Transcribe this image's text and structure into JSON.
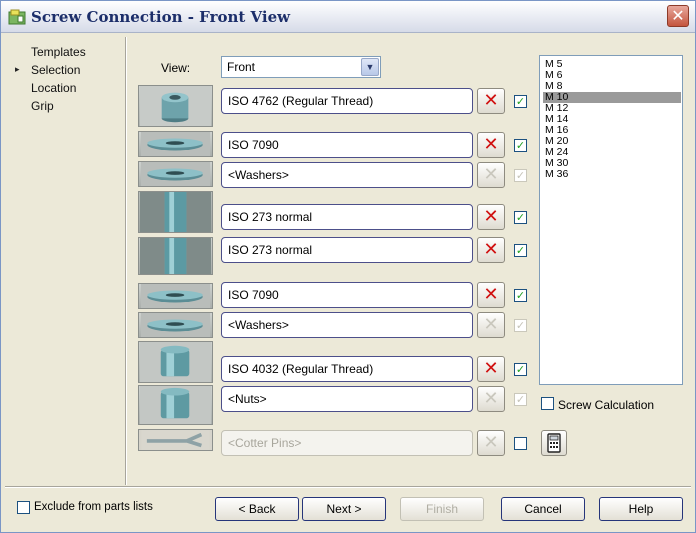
{
  "window": {
    "title": "Screw Connection - Front View",
    "close_glyph": "✕"
  },
  "nav": {
    "items": [
      {
        "label": "Templates",
        "active": false
      },
      {
        "label": "Selection",
        "active": true
      },
      {
        "label": "Location",
        "active": false
      },
      {
        "label": "Grip",
        "active": false
      }
    ],
    "active_marker": "▸"
  },
  "view": {
    "label": "View:",
    "value": "Front",
    "dropdown_glyph": "▼"
  },
  "components": [
    {
      "value": "ISO 4762 (Regular Thread)",
      "thumb": "cap-screw-icon",
      "enabled": true,
      "checked": true
    },
    {
      "value": "ISO 7090",
      "thumb": "washer-icon",
      "enabled": true,
      "checked": true
    },
    {
      "value": "<Washers>",
      "thumb": "washer-icon",
      "enabled": false,
      "checked": true
    },
    {
      "value": "ISO 273 normal",
      "thumb": "through-hole-icon",
      "enabled": true,
      "checked": true
    },
    {
      "value": "ISO 273 normal",
      "thumb": "through-hole-icon",
      "enabled": true,
      "checked": true
    },
    {
      "value": "ISO 7090",
      "thumb": "washer-icon",
      "enabled": true,
      "checked": true
    },
    {
      "value": "<Washers>",
      "thumb": "washer-icon",
      "enabled": false,
      "checked": true
    },
    {
      "value": "ISO 4032 (Regular Thread)",
      "thumb": "hex-nut-icon",
      "enabled": true,
      "checked": true
    },
    {
      "value": "<Nuts>",
      "thumb": "hex-nut-icon",
      "enabled": false,
      "checked": true
    },
    {
      "value": "<Cotter Pins>",
      "thumb": "cotter-pin-icon",
      "enabled": false,
      "checked": false
    }
  ],
  "remove_glyph": "✕",
  "check_glyph": "✓",
  "sizes": {
    "items": [
      "M 5",
      "M 6",
      "M 8",
      "M 10",
      "M 12",
      "M 14",
      "M 16",
      "M 20",
      "M 24",
      "M 30",
      "M 36"
    ],
    "selected": "M 10"
  },
  "screw_calculation": {
    "label": "Screw Calculation",
    "checked": false
  },
  "exclude_parts": {
    "label": "Exclude from parts lists",
    "checked": false
  },
  "buttons": {
    "back": "< Back",
    "next": "Next >",
    "finish": "Finish",
    "cancel": "Cancel",
    "help": "Help"
  },
  "colors": {
    "accent": "#26357a",
    "remove": "#d01010",
    "check": "#21a121",
    "selection": "#9a9a9a"
  }
}
